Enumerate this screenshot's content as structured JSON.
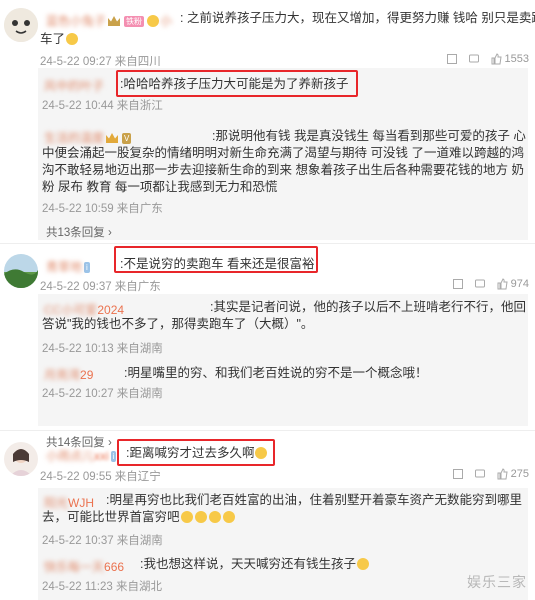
{
  "c1": {
    "tail": ":  之前说养孩子压力大，现在又增加，得更努力赚 钱哈 别只是卖跑",
    "tail2": "车了",
    "meta": "24-5-22 09:27 来自四川",
    "likes": "1553"
  },
  "c1_sub1": {
    "text": ":哈哈哈养孩子压力大可能是为了养新孩子",
    "meta": "24-5-22 10:44 来自浙江"
  },
  "c1_sub2": {
    "text": ":那说明他有钱 我是真没钱生 每当看到那些可爱的孩子 心中便会涌起一股复杂的情绪明明对新生命充满了渴望与期待 可没钱 了一道难以跨越的鸿沟不敢轻易地迈出那一步去迎接新生命的到来 想象着孩子出生后各种需要花钱的地方 奶粉 尿布 教育 每一项都让我感到无力和恐慌",
    "meta": "24-5-22 10:59 来自广东"
  },
  "c1_more": "共13条回复",
  "c2": {
    "text": ":不是说穷的卖跑车 看来还是很富裕",
    "meta": "24-5-22 09:37 来自广东",
    "likes": "974"
  },
  "c2_sub1": {
    "tag": "2024",
    "text": ":其实是记者问说，他的孩子以后不上班啃老行不行，他回答说\"我的钱也不多了，那得卖跑车了（大概）\"。",
    "meta": "24-5-22 10:13 来自湖南"
  },
  "c2_sub2": {
    "tag": "29",
    "text": ":明星嘴里的穷、和我们老百姓说的穷不是一个概念哦！",
    "meta": "24-5-22 10:27 来自湖南"
  },
  "c2_more": "共14条回复",
  "c3": {
    "tag": "xxi",
    "text": ":距离喊穷才过去多久啊",
    "meta": "24-5-22 09:55 来自辽宁",
    "likes": "275"
  },
  "c3_sub1": {
    "tag": "WJH",
    "text": ":明星再穷也比我们老百姓富的出油，住着别墅开着豪车资产无数能穷到哪里去，可能比世界首富穷吧",
    "meta": "24-5-22 10:37 来自湖南"
  },
  "c3_sub2": {
    "tag": "666",
    "text": ":我也想这样说，天天喊穷还有钱生孩子",
    "meta": "24-5-22 11:23 来自湖北"
  },
  "watermark": "娱乐三家",
  "colors": {
    "highlight_box": "#e8262a",
    "username": "#eb7350",
    "reply_bg": "#f5f5f5"
  }
}
